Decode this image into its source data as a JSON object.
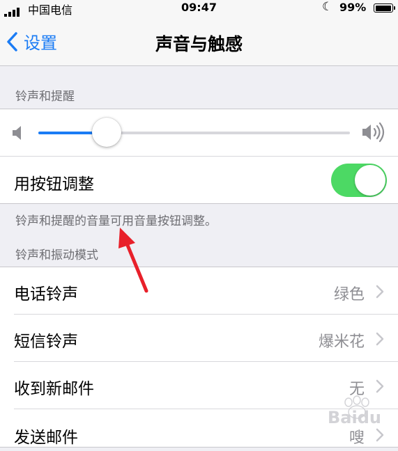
{
  "status_bar": {
    "carrier": "中国电信",
    "time": "09:47",
    "battery_percent": "99%",
    "battery_level": 0.99
  },
  "nav": {
    "back_label": "设置",
    "title": "声音与触感"
  },
  "ringer_section": {
    "header": "铃声和提醒",
    "volume_level": 0.22,
    "change_with_buttons_label": "用按钮调整",
    "change_with_buttons_on": true,
    "footer": "铃声和提醒的音量可用音量按钮调整。"
  },
  "patterns_section": {
    "header": "铃声和振动模式",
    "rows": [
      {
        "label": "电话铃声",
        "value": "绿色"
      },
      {
        "label": "短信铃声",
        "value": "爆米花"
      },
      {
        "label": "收到新邮件",
        "value": "无"
      },
      {
        "label": "发送邮件",
        "value": "嗖"
      }
    ]
  },
  "colors": {
    "accent": "#1b7cf5",
    "toggle_on": "#4cd964",
    "annotation_arrow": "#e8202a"
  },
  "icons": [
    "speaker-low-icon",
    "speaker-high-icon",
    "chevron-left-icon",
    "chevron-right-icon",
    "moon-icon",
    "battery-icon",
    "signal-icon"
  ]
}
